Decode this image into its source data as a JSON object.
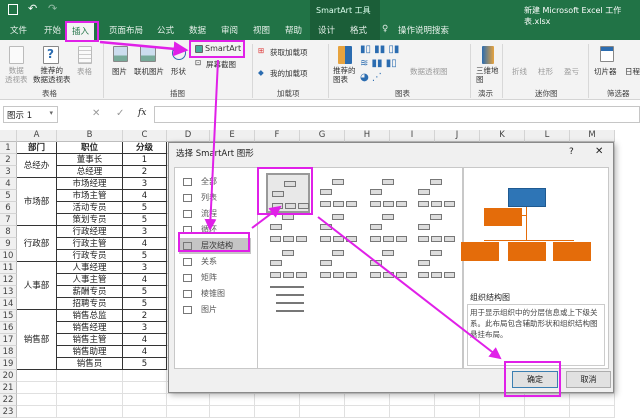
{
  "titlebar": {
    "context_tool": "SmartArt 工具",
    "doc_title": "新建 Microsoft Excel 工作表.xlsx"
  },
  "tabs": [
    {
      "label": "文件"
    },
    {
      "label": "开始"
    },
    {
      "label": "插入",
      "active": true
    },
    {
      "label": "页面布局"
    },
    {
      "label": "公式"
    },
    {
      "label": "数据"
    },
    {
      "label": "审阅"
    },
    {
      "label": "视图"
    },
    {
      "label": "帮助"
    },
    {
      "label": "设计"
    },
    {
      "label": "格式"
    },
    {
      "label": "操作说明搜索"
    }
  ],
  "ribbon": {
    "tables": {
      "pivot": "数据\n透视表",
      "recommended_pivot": "推荐的\n数据透视表",
      "table": "表格",
      "group": "表格"
    },
    "illustrations": {
      "picture": "图片",
      "online_picture": "联机图片",
      "shapes": "形状",
      "smartart": "SmartArt",
      "screenshot": "屏幕截图",
      "group": "插图"
    },
    "addins": {
      "get": "获取加载项",
      "my": "我的加载项",
      "group": "加载项"
    },
    "charts": {
      "recommended": "推荐的\n图表",
      "pivot_chart": "数据透视图",
      "group": "图表"
    },
    "tours": {
      "map3d": "三维地\n图",
      "group": "演示"
    },
    "sparklines": {
      "line": "折线",
      "column": "柱形",
      "winloss": "盈亏",
      "group": "迷你图"
    },
    "filters": {
      "slicer": "切片器",
      "timeline": "日程",
      "group": "筛选器"
    }
  },
  "formula_bar": {
    "name_box": "图示 1",
    "fx": "fx",
    "value": ""
  },
  "sheet": {
    "columns": [
      "A",
      "B",
      "C",
      "D",
      "E",
      "F",
      "G",
      "H",
      "I",
      "J",
      "K",
      "L",
      "M"
    ],
    "header": [
      "部门",
      "职位",
      "分级"
    ],
    "departments": [
      {
        "name": "总经办",
        "rows": [
          [
            "董事长",
            "1"
          ],
          [
            "总经理",
            "2"
          ]
        ]
      },
      {
        "name": "市场部",
        "rows": [
          [
            "市场经理",
            "3"
          ],
          [
            "市场主管",
            "4"
          ],
          [
            "活动专员",
            "5"
          ],
          [
            "策划专员",
            "5"
          ]
        ]
      },
      {
        "name": "行政部",
        "rows": [
          [
            "行政经理",
            "3"
          ],
          [
            "行政主管",
            "4"
          ],
          [
            "行政专员",
            "5"
          ]
        ]
      },
      {
        "name": "人事部",
        "rows": [
          [
            "人事经理",
            "3"
          ],
          [
            "人事主管",
            "4"
          ],
          [
            "薪酬专员",
            "5"
          ],
          [
            "招聘专员",
            "5"
          ]
        ]
      },
      {
        "name": "销售部",
        "rows": [
          [
            "销售总监",
            "2"
          ],
          [
            "销售经理",
            "3"
          ],
          [
            "销售主管",
            "4"
          ],
          [
            "销售助理",
            "4"
          ],
          [
            "销售员",
            "5"
          ]
        ]
      }
    ],
    "row_count": 23
  },
  "dialog": {
    "title": "选择 SmartArt 图形",
    "help": "?",
    "close": "✕",
    "categories": [
      "全部",
      "列表",
      "流程",
      "循环",
      "层次结构",
      "关系",
      "矩阵",
      "棱锥图",
      "图片"
    ],
    "selected_category": "层次结构",
    "preview_title": "组织结构图",
    "preview_desc": "用于显示组织中的分层信息或上下级关系。此布局包含辅助形状和组织结构图悬挂布局。",
    "ok": "确定",
    "cancel": "取消",
    "colors": {
      "top": "#2e75b6",
      "child": "#e46c0a"
    }
  },
  "annotation_color": "#e020e8"
}
